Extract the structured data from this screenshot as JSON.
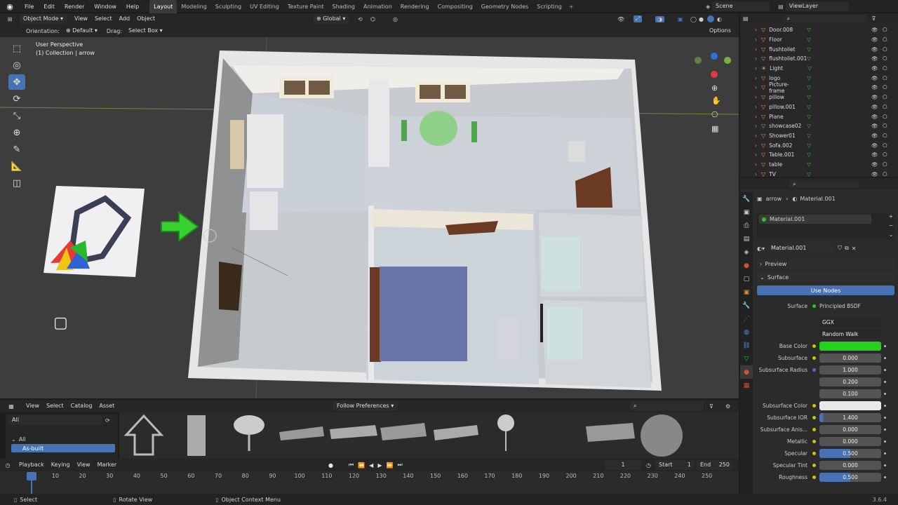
{
  "topbar": {
    "menus": [
      "File",
      "Edit",
      "Render",
      "Window",
      "Help"
    ],
    "workspaces": [
      "Layout",
      "Modeling",
      "Sculpting",
      "UV Editing",
      "Texture Paint",
      "Shading",
      "Animation",
      "Rendering",
      "Compositing",
      "Geometry Nodes",
      "Scripting"
    ],
    "active_workspace": "Layout",
    "scene": "Scene",
    "view_layer": "ViewLayer"
  },
  "viewport_header": {
    "mode": "Object Mode",
    "menus": [
      "View",
      "Select",
      "Add",
      "Object"
    ],
    "orientation": "Global"
  },
  "tool_settings": {
    "orientation_label": "Orientation:",
    "orientation_value": "Default",
    "drag_label": "Drag:",
    "drag_value": "Select Box",
    "options": "Options"
  },
  "viewport": {
    "perspective": "User Perspective",
    "collection": "(1) Collection | arrow"
  },
  "outliner": {
    "items": [
      "Door.008",
      "Floor",
      "flushtoilet",
      "flushtoilet.001",
      "Light",
      "logo",
      "Picture-frame",
      "pillow",
      "pillow.001",
      "Plane",
      "showcase02",
      "Shower01",
      "Sofa.002",
      "Table.001",
      "table",
      "TV"
    ]
  },
  "properties": {
    "breadcrumb_object": "arrow",
    "breadcrumb_material": "Material.001",
    "slot": "Material.001",
    "material_name": "Material.001",
    "preview": "Preview",
    "surface_panel": "Surface",
    "use_nodes": "Use Nodes",
    "surface_label": "Surface",
    "surface_value": "Principled BSDF",
    "distribution": "GGX",
    "subsurface_method": "Random Walk",
    "rows": [
      {
        "label": "Base Color",
        "value": "",
        "kind": "color",
        "color": "#22d31a"
      },
      {
        "label": "Subsurface",
        "value": "0.000",
        "kind": "num"
      },
      {
        "label": "Subsurface Radius",
        "value": "1.000",
        "kind": "num"
      },
      {
        "label": "",
        "value": "0.200",
        "kind": "num"
      },
      {
        "label": "",
        "value": "0.100",
        "kind": "num"
      },
      {
        "label": "Subsurface Color",
        "value": "",
        "kind": "color",
        "color": "#e8e8e8"
      },
      {
        "label": "Subsurface IOR",
        "value": "1.400",
        "kind": "num"
      },
      {
        "label": "Subsurface Anis...",
        "value": "0.000",
        "kind": "num"
      },
      {
        "label": "Metallic",
        "value": "0.000",
        "kind": "num"
      },
      {
        "label": "Specular",
        "value": "0.500",
        "kind": "bar",
        "fill": 0.5
      },
      {
        "label": "Specular Tint",
        "value": "0.000",
        "kind": "num"
      },
      {
        "label": "Roughness",
        "value": "0.500",
        "kind": "bar",
        "fill": 0.5
      }
    ]
  },
  "asset_browser": {
    "menus": [
      "View",
      "Select",
      "Catalog",
      "Asset"
    ],
    "library": "Follow Preferences",
    "filter": "All",
    "tree_all": "All",
    "tree_selected": "As-built"
  },
  "timeline": {
    "menus": [
      "Playback",
      "Keying",
      "View",
      "Marker"
    ],
    "current_frame": "1",
    "start_label": "Start",
    "start": "1",
    "end_label": "End",
    "end": "250",
    "ticks": [
      "1",
      "10",
      "20",
      "30",
      "40",
      "50",
      "60",
      "70",
      "80",
      "90",
      "100",
      "110",
      "120",
      "130",
      "140",
      "150",
      "160",
      "170",
      "180",
      "190",
      "200",
      "210",
      "220",
      "230",
      "240",
      "250"
    ]
  },
  "statusbar": {
    "select": "Select",
    "rotate": "Rotate View",
    "context": "Object Context Menu",
    "version": "3.6.4"
  },
  "colors": {
    "accent": "#4772b3",
    "green": "#2ec22a"
  }
}
